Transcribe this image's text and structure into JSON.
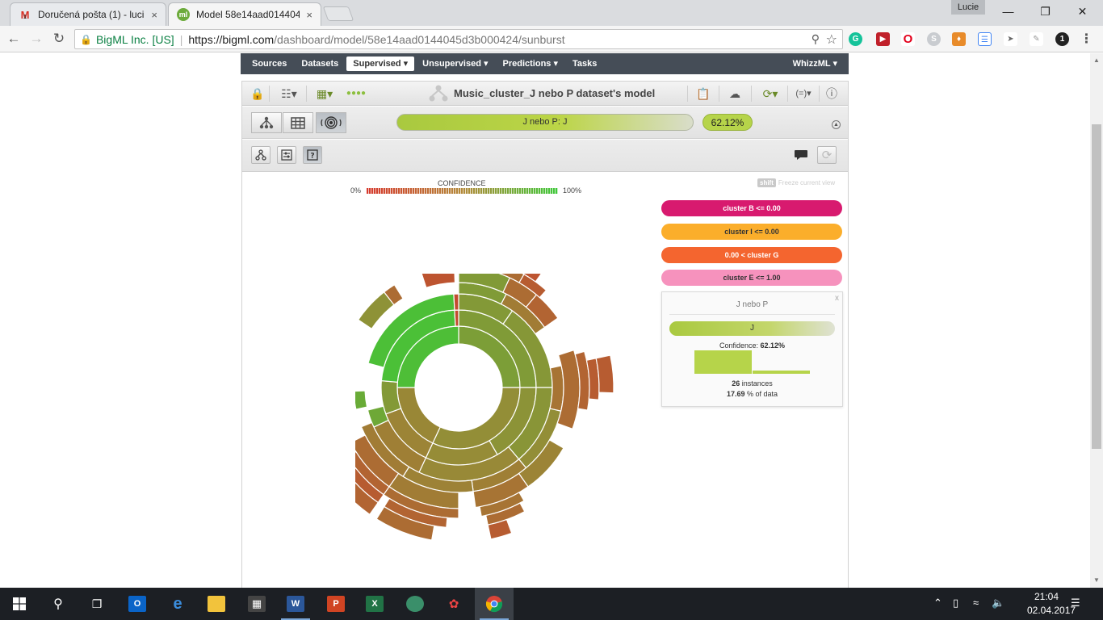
{
  "browser": {
    "tabs": [
      {
        "title": "Doručená pošta (1) - luci",
        "icon": "gmail-icon"
      },
      {
        "title": "Model 58e14aad014404",
        "icon": "bigml-icon"
      }
    ],
    "profile_name": "Lucie",
    "org": "BigML Inc. [US]",
    "url_host": "https://bigml.com",
    "url_path": "/dashboard/model/58e14aad0144045d3b000424/sunburst",
    "tab_close": "×",
    "mail_badge": "1",
    "ext_badge": "1"
  },
  "nav": {
    "items": [
      "Sources",
      "Datasets",
      "Supervised ▾",
      "Unsupervised ▾",
      "Predictions ▾",
      "Tasks"
    ],
    "right": "WhizzML ▾"
  },
  "model": {
    "title": "Music_cluster_J nebo P dataset's model"
  },
  "prediction": {
    "label": "J nebo P: J",
    "confidence": "62.12%",
    "confidence_fraction": 0.6212
  },
  "legend": {
    "title": "CONFIDENCE",
    "min": "0%",
    "max": "100%",
    "shift_key": "shift",
    "shift_hint": "Freeze current view"
  },
  "rules": [
    {
      "text": "cluster B <= 0.00",
      "color": "#d81a6f",
      "text_color": "#ffffff"
    },
    {
      "text": "cluster I <= 0.00",
      "color": "#fbae2b",
      "text_color": "#333333"
    },
    {
      "text": "0.00 < cluster G",
      "color": "#f4652f",
      "text_color": "#ffffff"
    },
    {
      "text": "cluster E <= 1.00",
      "color": "#f692bd",
      "text_color": "#333333"
    }
  ],
  "panel": {
    "title": "J nebo P",
    "close": "x",
    "prediction": "J",
    "confidence_label": "Confidence:",
    "confidence_value": "62.12%",
    "instances_value": "26",
    "instances_label": "instances",
    "data_value": "17.69",
    "data_label": "% of data",
    "distribution": [
      0.6212,
      0.3788
    ]
  },
  "taskbar": {
    "time": "21:04",
    "date": "02.04.2017"
  },
  "colors": {
    "accent_green": "#b6d44a",
    "nav_bg": "#454d57"
  }
}
